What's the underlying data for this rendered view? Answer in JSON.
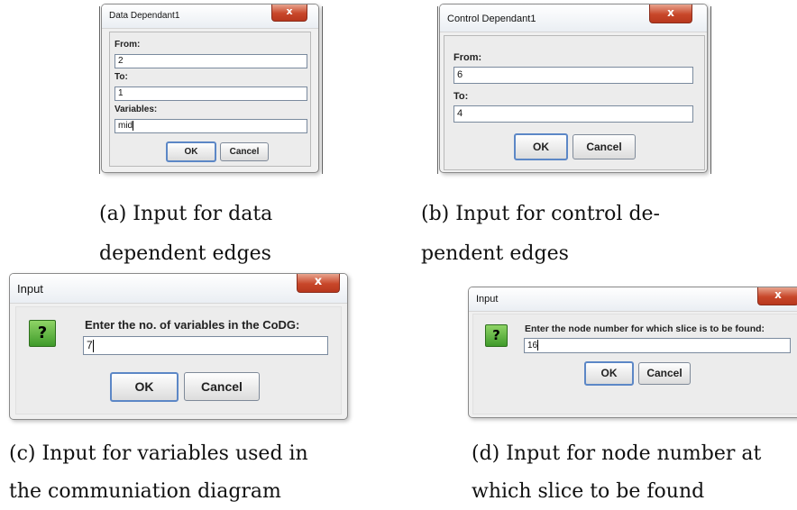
{
  "dialogs": {
    "a": {
      "title": "Data Dependant1",
      "close_glyph": "x",
      "from_label": "From:",
      "from_value": "2",
      "to_label": "To:",
      "to_value": "1",
      "variables_label": "Variables:",
      "variables_value": "mid",
      "ok_label": "OK",
      "cancel_label": "Cancel"
    },
    "b": {
      "title": "Control Dependant1",
      "close_glyph": "x",
      "from_label": "From:",
      "from_value": "6",
      "to_label": "To:",
      "to_value": "4",
      "ok_label": "OK",
      "cancel_label": "Cancel"
    },
    "c": {
      "title": "Input",
      "close_glyph": "x",
      "question_glyph": "?",
      "prompt": "Enter the no. of variables in the CoDG:",
      "value": "7",
      "ok_label": "OK",
      "cancel_label": "Cancel"
    },
    "d": {
      "title": "Input",
      "close_glyph": "x",
      "question_glyph": "?",
      "prompt": "Enter the node number for which slice is to be found:",
      "value": "16",
      "ok_label": "OK",
      "cancel_label": "Cancel"
    }
  },
  "captions": {
    "a_line1": "(a) Input for data",
    "a_line2": "dependent edges",
    "b_line1": "(b) Input for control de-",
    "b_line2": "pendent edges",
    "c_line1": "(c) Input for variables used in",
    "c_line2": "the communiation diagram",
    "d_line1": "(d) Input for node number at",
    "d_line2": "which slice to be found"
  },
  "colors": {
    "close_button": "#c8472a",
    "question_icon": "#5bb53a",
    "focus_border": "#5c87c6"
  },
  "icons": {
    "close": "close-icon",
    "question": "question-icon"
  }
}
